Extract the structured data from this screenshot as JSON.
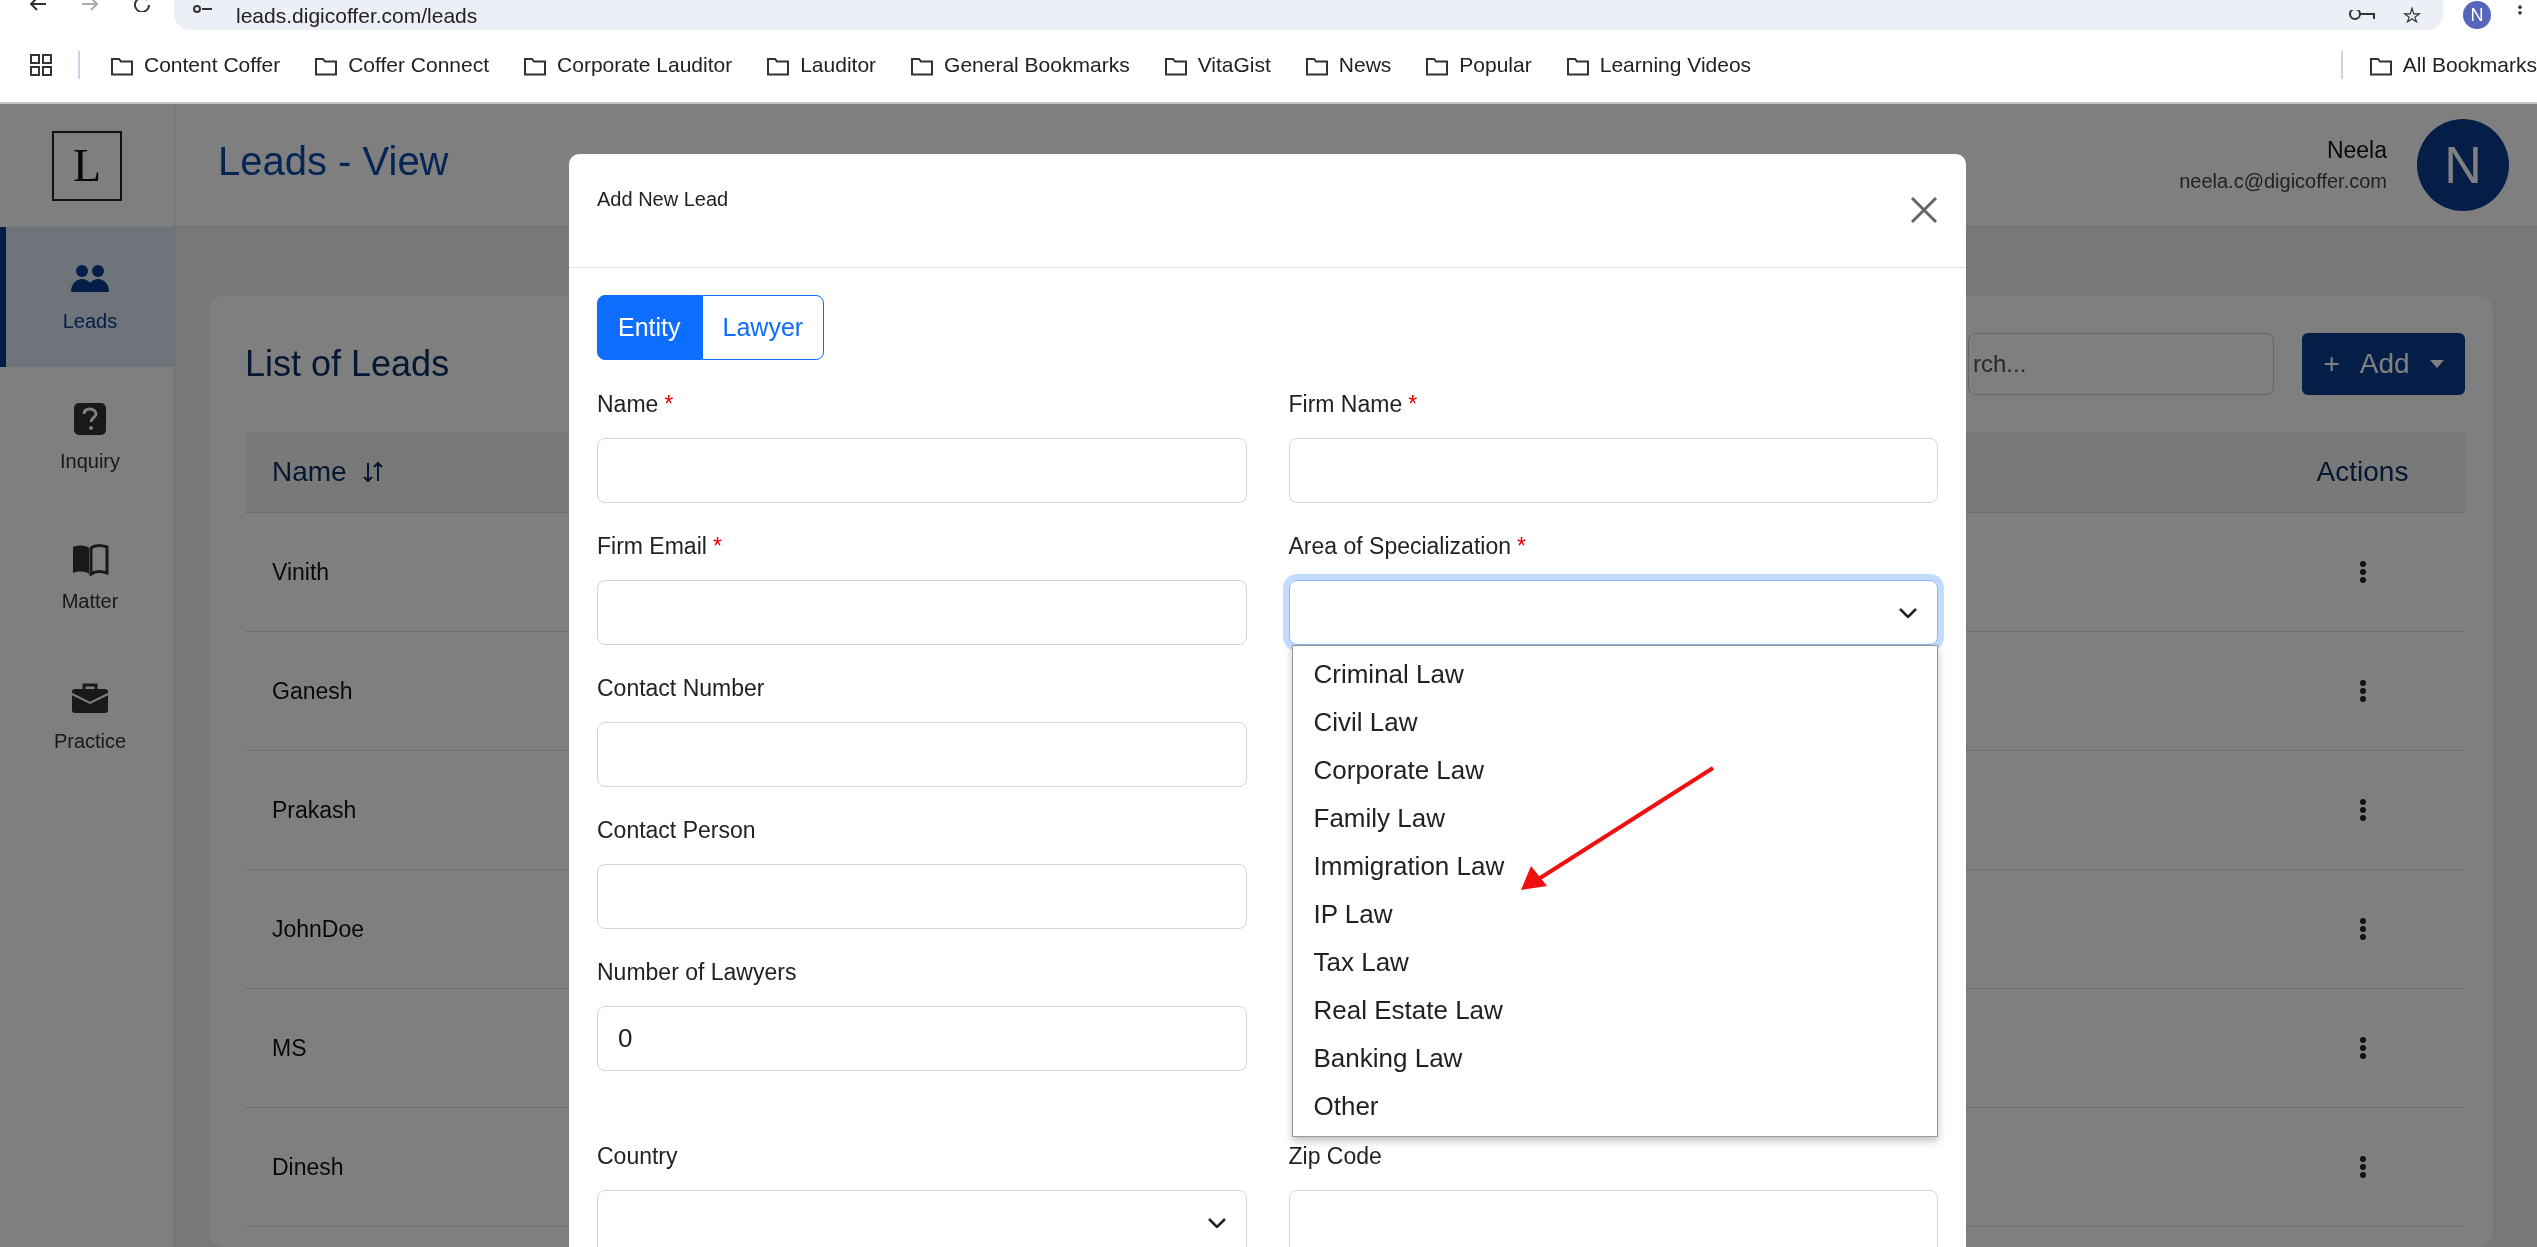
{
  "browser": {
    "url": "leads.digicoffer.com/leads",
    "profile_initial": "N",
    "bookmarks": [
      {
        "label": "Content Coffer"
      },
      {
        "label": "Coffer Connect"
      },
      {
        "label": "Corporate Lauditor"
      },
      {
        "label": "Lauditor"
      },
      {
        "label": "General Bookmarks"
      },
      {
        "label": "VitaGist"
      },
      {
        "label": "News"
      },
      {
        "label": "Popular"
      },
      {
        "label": "Learning Videos"
      }
    ],
    "all_bookmarks": "All Bookmarks"
  },
  "app": {
    "logo": "L",
    "page_title": "Leads - View",
    "nav": [
      {
        "label": "Leads",
        "kind": "people",
        "selected": true
      },
      {
        "label": "Inquiry",
        "kind": "question",
        "selected": false
      },
      {
        "label": "Matter",
        "kind": "book",
        "selected": false
      },
      {
        "label": "Practice",
        "kind": "briefcase",
        "selected": false
      }
    ],
    "user": {
      "name": "Neela",
      "email": "neela.c@digicoffer.com",
      "initial": "N"
    }
  },
  "list": {
    "title": "List of Leads",
    "search": {
      "placeholder": "rch..."
    },
    "add_button": {
      "icon": "+",
      "label": "Add"
    },
    "columns": [
      {
        "label": "Name",
        "sortable": true
      },
      {
        "label": "Actions",
        "sortable": false
      }
    ],
    "rows": [
      {
        "name": "Vinith"
      },
      {
        "name": "Ganesh"
      },
      {
        "name": "Prakash"
      },
      {
        "name": "JohnDoe"
      },
      {
        "name": "MS"
      },
      {
        "name": "Dinesh"
      }
    ]
  },
  "modal": {
    "title": "Add New Lead",
    "tabs": [
      {
        "label": "Entity",
        "selected": true
      },
      {
        "label": "Lawyer",
        "selected": false
      }
    ],
    "rows": [
      {
        "left": {
          "label": "Name",
          "required_mark": "*",
          "kind": "text"
        },
        "right": {
          "label": "Firm Name",
          "required_mark": "*",
          "kind": "text"
        }
      },
      {
        "left": {
          "label": "Firm Email",
          "required_mark": "*",
          "kind": "text"
        },
        "right": {
          "label": "Area of Specialization",
          "required_mark": "*",
          "kind": "select",
          "focused": true,
          "expanded": true,
          "options": [
            "Criminal Law",
            "Civil Law",
            "Corporate Law",
            "Family Law",
            "Immigration Law",
            "IP Law",
            "Tax Law",
            "Real Estate Law",
            "Banking Law",
            "Other"
          ]
        }
      },
      {
        "left": {
          "label": "Contact Number",
          "kind": "text"
        }
      },
      {
        "left": {
          "label": "Contact Person",
          "kind": "text"
        }
      },
      {
        "left": {
          "label": "Number of Lawyers",
          "kind": "text",
          "value": "0"
        }
      },
      {
        "left": {
          "label": "Country",
          "kind": "select",
          "focused": false,
          "expanded": false
        },
        "right": {
          "label": "Zip Code",
          "kind": "text"
        }
      }
    ]
  }
}
